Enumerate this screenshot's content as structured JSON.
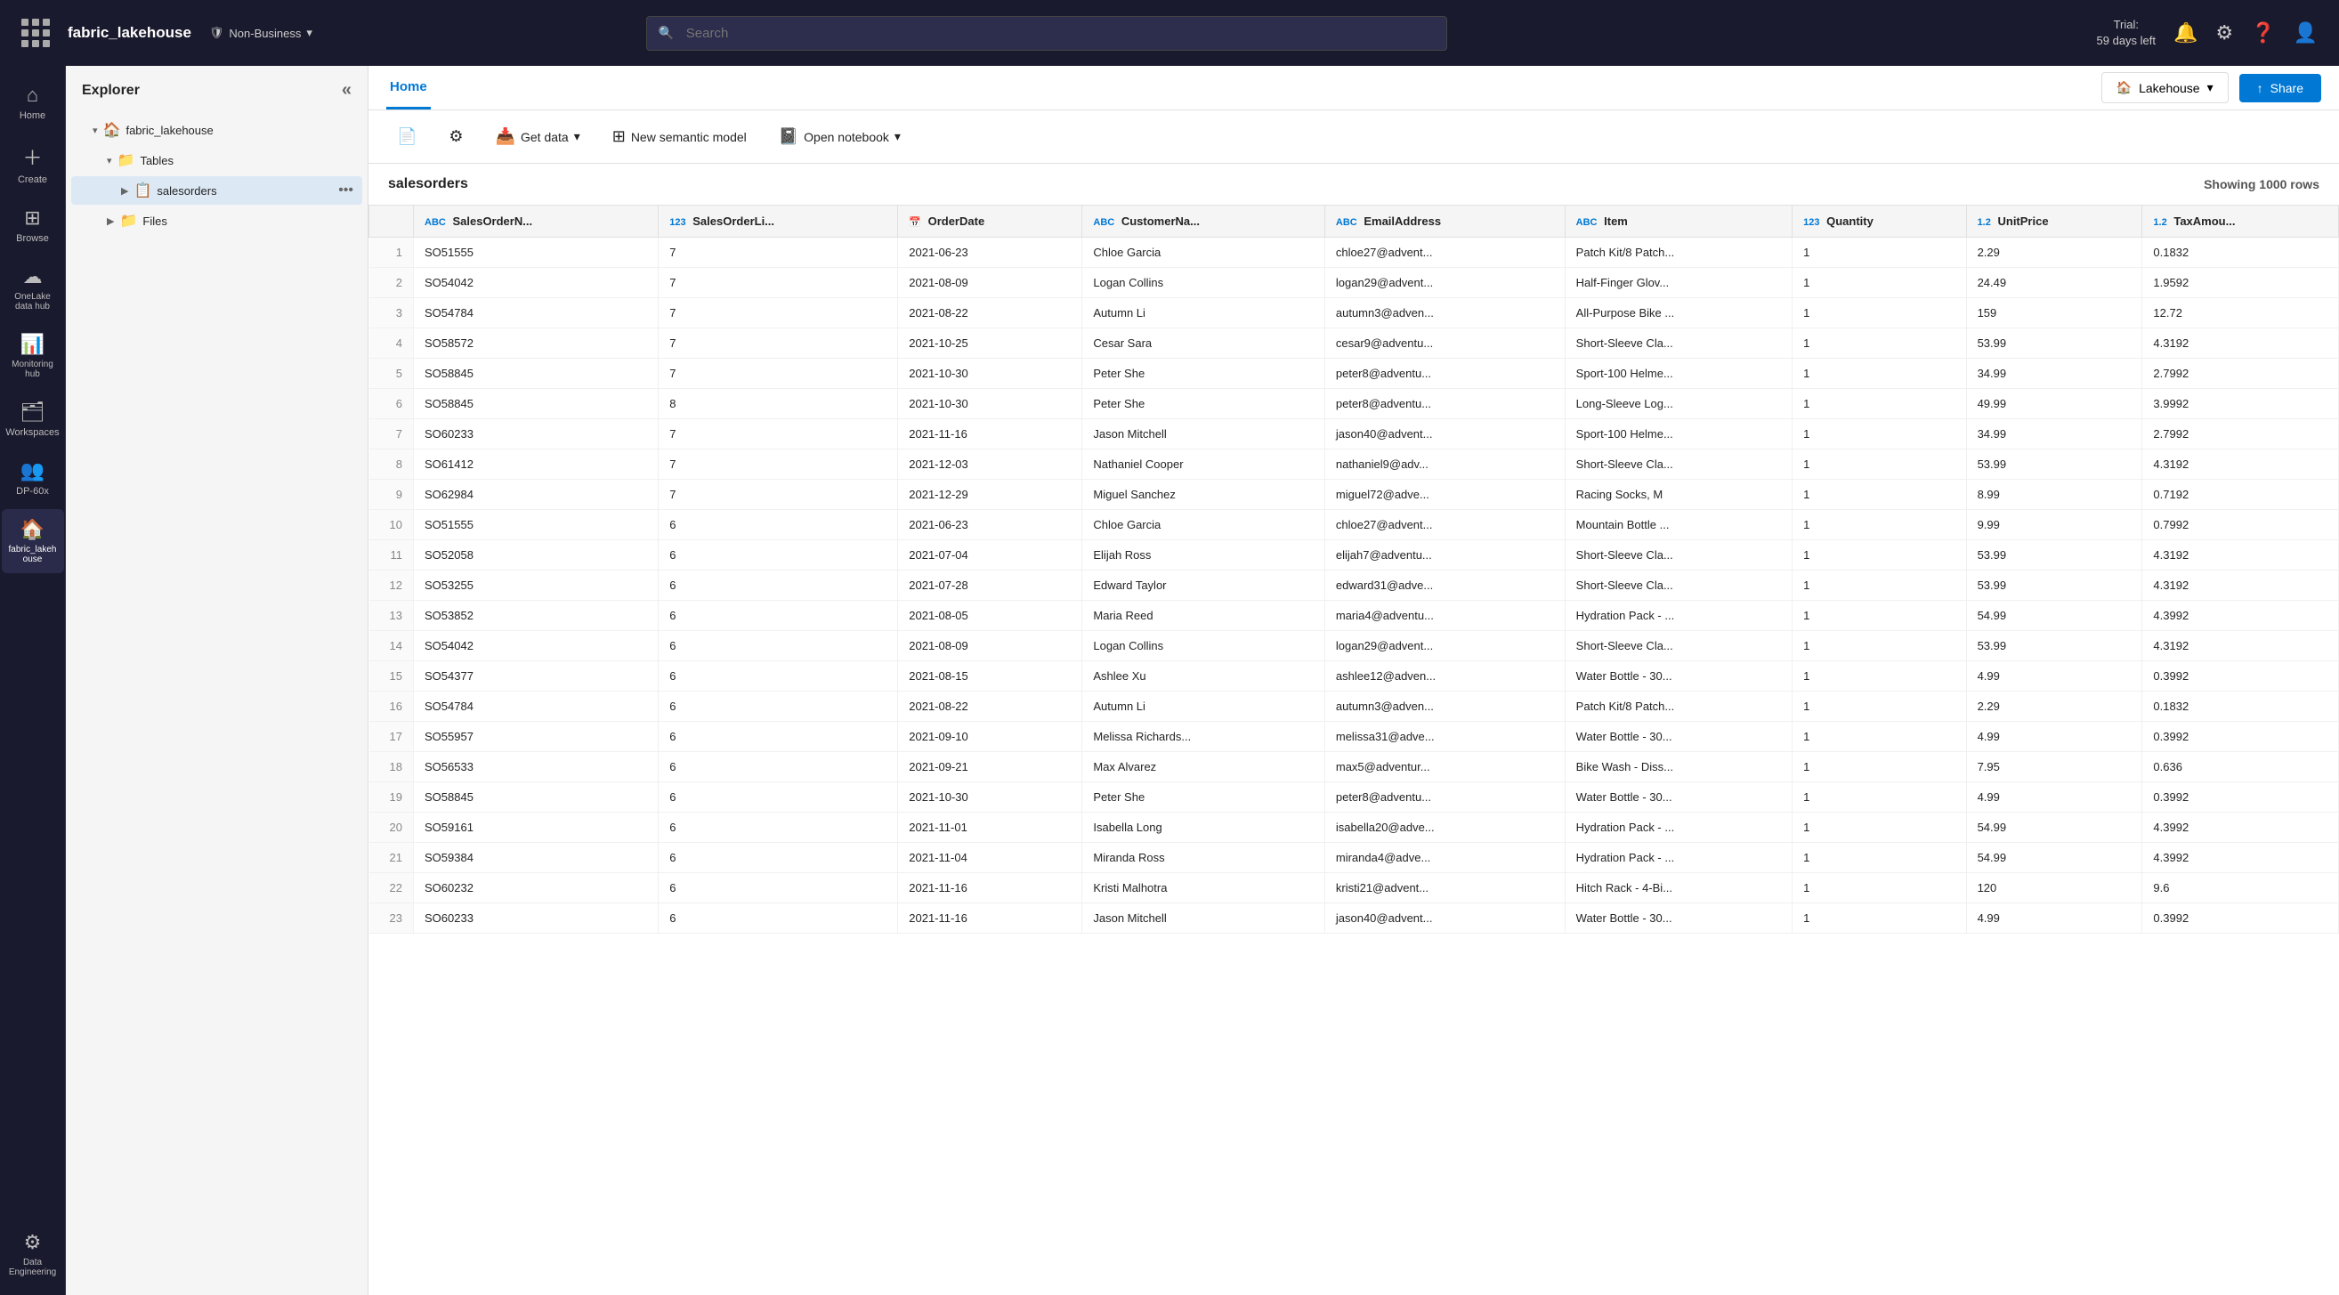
{
  "topnav": {
    "brand": "fabric_lakehouse",
    "classification": "Non-Business",
    "search_placeholder": "Search",
    "trial_line1": "Trial:",
    "trial_line2": "59 days left"
  },
  "icon_sidebar": {
    "items": [
      {
        "id": "home",
        "label": "Home",
        "glyph": "⌂",
        "active": false
      },
      {
        "id": "create",
        "label": "Create",
        "glyph": "＋",
        "active": false
      },
      {
        "id": "browse",
        "label": "Browse",
        "glyph": "⊞",
        "active": false
      },
      {
        "id": "onelake",
        "label": "OneLake data hub",
        "glyph": "☁",
        "active": false
      },
      {
        "id": "monitoring",
        "label": "Monitoring hub",
        "glyph": "📊",
        "active": false
      },
      {
        "id": "workspaces",
        "label": "Workspaces",
        "glyph": "🗂",
        "active": false
      },
      {
        "id": "dp60x",
        "label": "DP-60x",
        "glyph": "👥",
        "active": false
      },
      {
        "id": "fabriclakehouse",
        "label": "fabric_lakehouse",
        "glyph": "🏠",
        "active": true
      },
      {
        "id": "dataengineering",
        "label": "Data Engineering",
        "glyph": "⚙",
        "active": false
      }
    ]
  },
  "explorer": {
    "title": "Explorer",
    "root": "fabric_lakehouse",
    "tables_label": "Tables",
    "table_name": "salesorders",
    "files_label": "Files"
  },
  "ribbon": {
    "home_tab": "Home",
    "lakehouse_label": "Lakehouse",
    "share_label": "Share",
    "buttons": [
      {
        "id": "new-query",
        "label": "",
        "icon": "📄"
      },
      {
        "id": "settings",
        "label": "",
        "icon": "⚙"
      },
      {
        "id": "get-data",
        "label": "Get data",
        "icon": "📥",
        "has_arrow": true
      },
      {
        "id": "new-semantic-model",
        "label": "New semantic model",
        "icon": "⊞"
      },
      {
        "id": "open-notebook",
        "label": "Open notebook",
        "icon": "📓",
        "has_arrow": true
      }
    ]
  },
  "table": {
    "name": "salesorders",
    "showing_rows": "Showing 1000 rows",
    "columns": [
      {
        "name": "SalesOrderN...",
        "type": "ABC"
      },
      {
        "name": "SalesOrderLi...",
        "type": "123"
      },
      {
        "name": "OrderDate",
        "type": "📅"
      },
      {
        "name": "CustomerNa...",
        "type": "ABC"
      },
      {
        "name": "EmailAddress",
        "type": "ABC"
      },
      {
        "name": "Item",
        "type": "ABC"
      },
      {
        "name": "Quantity",
        "type": "123"
      },
      {
        "name": "UnitPrice",
        "type": "1.2"
      },
      {
        "name": "TaxAmou...",
        "type": "1.2"
      }
    ],
    "rows": [
      [
        1,
        "SO51555",
        "7",
        "2021-06-23",
        "Chloe Garcia",
        "chloe27@advent...",
        "Patch Kit/8 Patch...",
        "1",
        "2.29",
        "0.1832"
      ],
      [
        2,
        "SO54042",
        "7",
        "2021-08-09",
        "Logan Collins",
        "logan29@advent...",
        "Half-Finger Glov...",
        "1",
        "24.49",
        "1.9592"
      ],
      [
        3,
        "SO54784",
        "7",
        "2021-08-22",
        "Autumn Li",
        "autumn3@adven...",
        "All-Purpose Bike ...",
        "1",
        "159",
        "12.72"
      ],
      [
        4,
        "SO58572",
        "7",
        "2021-10-25",
        "Cesar Sara",
        "cesar9@adventu...",
        "Short-Sleeve Cla...",
        "1",
        "53.99",
        "4.3192"
      ],
      [
        5,
        "SO58845",
        "7",
        "2021-10-30",
        "Peter She",
        "peter8@adventu...",
        "Sport-100 Helme...",
        "1",
        "34.99",
        "2.7992"
      ],
      [
        6,
        "SO58845",
        "8",
        "2021-10-30",
        "Peter She",
        "peter8@adventu...",
        "Long-Sleeve Log...",
        "1",
        "49.99",
        "3.9992"
      ],
      [
        7,
        "SO60233",
        "7",
        "2021-11-16",
        "Jason Mitchell",
        "jason40@advent...",
        "Sport-100 Helme...",
        "1",
        "34.99",
        "2.7992"
      ],
      [
        8,
        "SO61412",
        "7",
        "2021-12-03",
        "Nathaniel Cooper",
        "nathaniel9@adv...",
        "Short-Sleeve Cla...",
        "1",
        "53.99",
        "4.3192"
      ],
      [
        9,
        "SO62984",
        "7",
        "2021-12-29",
        "Miguel Sanchez",
        "miguel72@adve...",
        "Racing Socks, M",
        "1",
        "8.99",
        "0.7192"
      ],
      [
        10,
        "SO51555",
        "6",
        "2021-06-23",
        "Chloe Garcia",
        "chloe27@advent...",
        "Mountain Bottle ...",
        "1",
        "9.99",
        "0.7992"
      ],
      [
        11,
        "SO52058",
        "6",
        "2021-07-04",
        "Elijah Ross",
        "elijah7@adventu...",
        "Short-Sleeve Cla...",
        "1",
        "53.99",
        "4.3192"
      ],
      [
        12,
        "SO53255",
        "6",
        "2021-07-28",
        "Edward Taylor",
        "edward31@adve...",
        "Short-Sleeve Cla...",
        "1",
        "53.99",
        "4.3192"
      ],
      [
        13,
        "SO53852",
        "6",
        "2021-08-05",
        "Maria Reed",
        "maria4@adventu...",
        "Hydration Pack - ...",
        "1",
        "54.99",
        "4.3992"
      ],
      [
        14,
        "SO54042",
        "6",
        "2021-08-09",
        "Logan Collins",
        "logan29@advent...",
        "Short-Sleeve Cla...",
        "1",
        "53.99",
        "4.3192"
      ],
      [
        15,
        "SO54377",
        "6",
        "2021-08-15",
        "Ashlee Xu",
        "ashlee12@adven...",
        "Water Bottle - 30...",
        "1",
        "4.99",
        "0.3992"
      ],
      [
        16,
        "SO54784",
        "6",
        "2021-08-22",
        "Autumn Li",
        "autumn3@adven...",
        "Patch Kit/8 Patch...",
        "1",
        "2.29",
        "0.1832"
      ],
      [
        17,
        "SO55957",
        "6",
        "2021-09-10",
        "Melissa Richards...",
        "melissa31@adve...",
        "Water Bottle - 30...",
        "1",
        "4.99",
        "0.3992"
      ],
      [
        18,
        "SO56533",
        "6",
        "2021-09-21",
        "Max Alvarez",
        "max5@adventur...",
        "Bike Wash - Diss...",
        "1",
        "7.95",
        "0.636"
      ],
      [
        19,
        "SO58845",
        "6",
        "2021-10-30",
        "Peter She",
        "peter8@adventu...",
        "Water Bottle - 30...",
        "1",
        "4.99",
        "0.3992"
      ],
      [
        20,
        "SO59161",
        "6",
        "2021-11-01",
        "Isabella Long",
        "isabella20@adve...",
        "Hydration Pack - ...",
        "1",
        "54.99",
        "4.3992"
      ],
      [
        21,
        "SO59384",
        "6",
        "2021-11-04",
        "Miranda Ross",
        "miranda4@adve...",
        "Hydration Pack - ...",
        "1",
        "54.99",
        "4.3992"
      ],
      [
        22,
        "SO60232",
        "6",
        "2021-11-16",
        "Kristi Malhotra",
        "kristi21@advent...",
        "Hitch Rack - 4-Bi...",
        "1",
        "120",
        "9.6"
      ],
      [
        23,
        "SO60233",
        "6",
        "2021-11-16",
        "Jason Mitchell",
        "jason40@advent...",
        "Water Bottle - 30...",
        "1",
        "4.99",
        "0.3992"
      ]
    ]
  }
}
